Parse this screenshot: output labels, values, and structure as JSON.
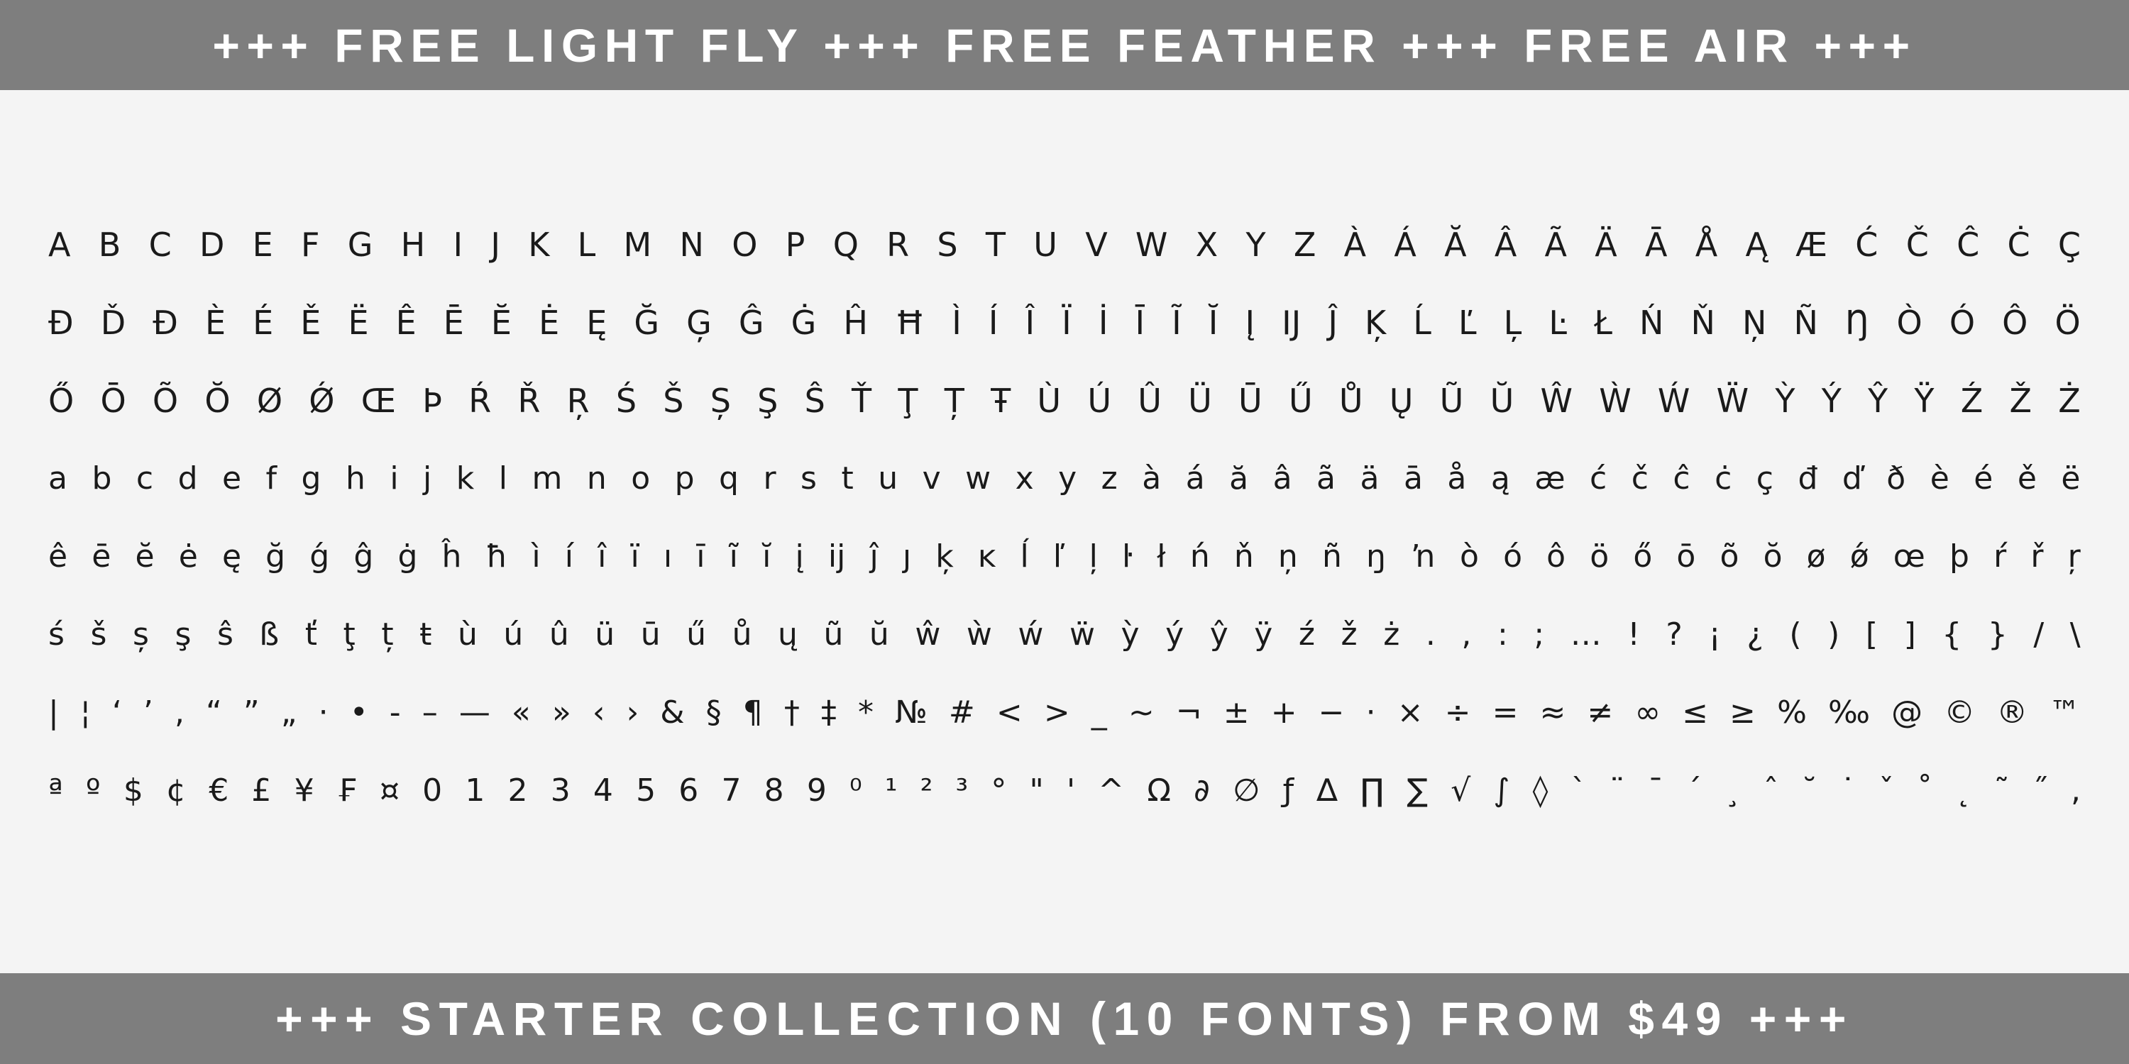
{
  "banner_top": {
    "text": "+++ FREE LIGHT FLY +++ FREE FEATHER +++ FREE AIR +++"
  },
  "banner_bottom": {
    "text": "+++ STARTER COLLECTION (10 FONTS) FROM $49 +++"
  },
  "glyph_rows": [
    [
      "A",
      "B",
      "C",
      "D",
      "E",
      "F",
      "G",
      "H",
      "I",
      "J",
      "K",
      "L",
      "M",
      "N",
      "O",
      "P",
      "Q",
      "R",
      "S",
      "T",
      "U",
      "V",
      "W",
      "X",
      "Y",
      "Z",
      "À",
      "Á",
      "Ă",
      "Â",
      "Ã",
      "Ä",
      "Ā",
      "Å",
      "Ą",
      "Æ",
      "Ć",
      "Č",
      "Ĉ",
      "Ċ",
      "Ç"
    ],
    [
      "Ð",
      "Ď",
      "Đ",
      "È",
      "É",
      "Ě",
      "Ë",
      "Ê",
      "Ē",
      "Ĕ",
      "Ė",
      "Ę",
      "Ğ",
      "Ģ",
      "Ĝ",
      "Ġ",
      "Ĥ",
      "Ħ",
      "Ì",
      "Í",
      "Î",
      "Ï",
      "İ",
      "Ī",
      "Ĩ",
      "Ĭ",
      "Į",
      "Ĳ",
      "Ĵ",
      "Ķ",
      "Ĺ",
      "Ľ",
      "Ļ",
      "Ŀ",
      "Ł",
      "Ń",
      "Ň",
      "Ņ",
      "Ñ",
      "Ŋ",
      "Ò",
      "Ó",
      "Ô",
      "Ö"
    ],
    [
      "Ő",
      "Ō",
      "Õ",
      "Ŏ",
      "Ø",
      "Ǿ",
      "Œ",
      "Þ",
      "Ŕ",
      "Ř",
      "Ŗ",
      "Ś",
      "Š",
      "Ș",
      "Ş",
      "Ŝ",
      "Ť",
      "Ţ",
      "Ț",
      "Ŧ",
      "Ù",
      "Ú",
      "Û",
      "Ü",
      "Ū",
      "Ű",
      "Ů",
      "Ų",
      "Ũ",
      "Ŭ",
      "Ŵ",
      "Ẁ",
      "Ẃ",
      "Ẅ",
      "Ỳ",
      "Ý",
      "Ŷ",
      "Ÿ",
      "Ź",
      "Ž",
      "Ż"
    ],
    [
      "a",
      "b",
      "c",
      "d",
      "e",
      "f",
      "g",
      "h",
      "i",
      "j",
      "k",
      "l",
      "m",
      "n",
      "o",
      "p",
      "q",
      "r",
      "s",
      "t",
      "u",
      "v",
      "w",
      "x",
      "y",
      "z",
      "à",
      "á",
      "ă",
      "â",
      "ã",
      "ä",
      "ā",
      "å",
      "ą",
      "æ",
      "ć",
      "č",
      "ĉ",
      "ċ",
      "ç",
      "đ",
      "ď",
      "ð",
      "è",
      "é",
      "ě",
      "ë"
    ],
    [
      "ê",
      "ē",
      "ĕ",
      "ė",
      "ę",
      "ğ",
      "ǵ",
      "ĝ",
      "ġ",
      "ĥ",
      "ħ",
      "ì",
      "í",
      "î",
      "ï",
      "ı",
      "ī",
      "ĩ",
      "ĭ",
      "į",
      "ĳ",
      "ĵ",
      "ȷ",
      "ķ",
      "ĸ",
      "ĺ",
      "ľ",
      "ļ",
      "ŀ",
      "ł",
      "ń",
      "ň",
      "ņ",
      "ñ",
      "ŋ",
      "ŉ",
      "ò",
      "ó",
      "ô",
      "ö",
      "ő",
      "ō",
      "õ",
      "ŏ",
      "ø",
      "ǿ",
      "œ",
      "þ",
      "ŕ",
      "ř",
      "ŗ"
    ],
    [
      "ś",
      "š",
      "ș",
      "ş",
      "ŝ",
      "ß",
      "ť",
      "ţ",
      "ț",
      "ŧ",
      "ù",
      "ú",
      "û",
      "ü",
      "ū",
      "ű",
      "ů",
      "ų",
      "ũ",
      "ŭ",
      "ŵ",
      "ẁ",
      "ẃ",
      "ẅ",
      "ỳ",
      "ý",
      "ŷ",
      "ÿ",
      "ź",
      "ž",
      "ż",
      ".",
      ",",
      ":",
      ";",
      "…",
      "!",
      "?",
      "¡",
      "¿",
      "(",
      ")",
      "[",
      "]",
      "{",
      "}",
      "/",
      "\\"
    ],
    [
      "|",
      "¦",
      "‘",
      "’",
      ",",
      "“",
      "”",
      "„",
      "·",
      "•",
      "-",
      "–",
      "—",
      "«",
      "»",
      "‹",
      "›",
      "&",
      "§",
      "¶",
      "†",
      "‡",
      "*",
      "№",
      "#",
      "<",
      ">",
      "_",
      "~",
      "¬",
      "±",
      "+",
      "−",
      "·",
      "×",
      "÷",
      "=",
      "≈",
      "≠",
      "∞",
      "≤",
      "≥",
      "%",
      "‰",
      "@",
      "©",
      "®",
      "™"
    ],
    [
      "ª",
      "º",
      "$",
      "¢",
      "€",
      "£",
      "¥",
      "₣",
      "¤",
      "0",
      "1",
      "2",
      "3",
      "4",
      "5",
      "6",
      "7",
      "8",
      "9",
      "⁰",
      "¹",
      "²",
      "³",
      "°",
      "\"",
      "'",
      "^",
      "Ω",
      "∂",
      "∅",
      "ƒ",
      "∆",
      "∏",
      "∑",
      "√",
      "∫",
      "◊",
      "`",
      "¨",
      "¯",
      "´",
      "¸",
      "ˆ",
      "˘",
      "˙",
      "ˇ",
      "˚",
      "˛",
      "˜",
      "˝",
      ","
    ]
  ]
}
